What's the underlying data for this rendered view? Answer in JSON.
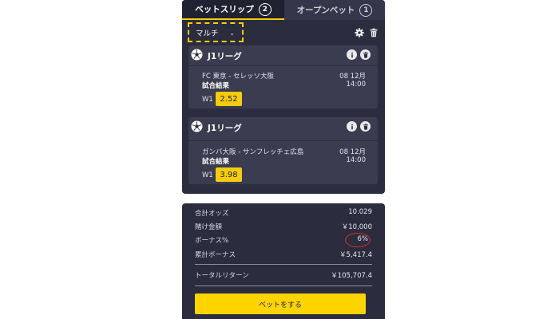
{
  "tabs": {
    "betslip": {
      "label": "ベットスリップ",
      "count": "2"
    },
    "openbets": {
      "label": "オープンベット",
      "count": "1"
    }
  },
  "toolbar": {
    "mode": "マルチ",
    "chevron": "⌄"
  },
  "bets": [
    {
      "league": "J1リーグ",
      "match": "FC 東京 - セレッソ大阪",
      "market": "試合結果",
      "date": "08 12月",
      "time": "14:00",
      "selection": "W1",
      "odds": "2.52"
    },
    {
      "league": "J1リーグ",
      "match": "ガンバ大阪 - サンフレッチェ広島",
      "market": "試合結果",
      "date": "08 12月",
      "time": "14:00",
      "selection": "W1",
      "odds": "3.98"
    }
  ],
  "summary": {
    "total_odds_label": "合計オッズ",
    "total_odds": "10.029",
    "stake_label": "賭け金額",
    "stake": "￥10,000",
    "bonus_pct_label": "ボーナス%",
    "bonus_pct": "6%",
    "total_bonus_label": "累計ボーナス",
    "total_bonus": "￥5,417.4",
    "total_return_label": "トータルリターン",
    "total_return": "￥105,707.4"
  },
  "place_bet_label": "ベットをする",
  "colors": {
    "accent": "#f5cc0b",
    "panel": "#2b2c3e",
    "card": "#3b3c50",
    "highlight_circle": "#d52a2a"
  }
}
